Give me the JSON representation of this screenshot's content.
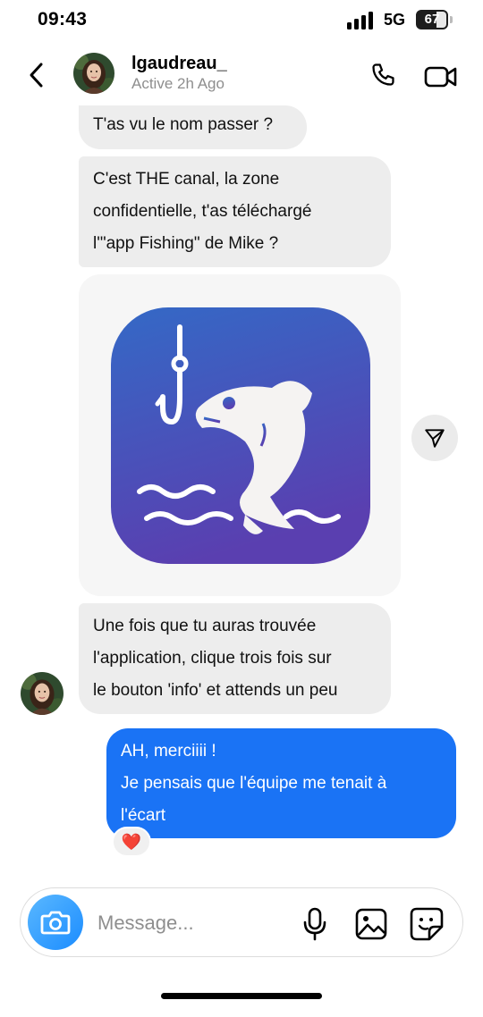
{
  "status_bar": {
    "time": "09:43",
    "network": "5G",
    "battery": "67",
    "battery_level": 0.67
  },
  "header": {
    "name": "lgaudreau_",
    "status": "Active 2h Ago"
  },
  "messages": {
    "m1": {
      "line1": "T'as vu le nom passer ?"
    },
    "m2": {
      "line1": "C'est THE canal, la zone",
      "line2": "confidentielle, t'as téléchargé",
      "line3": "l'\"app Fishing\" de Mike ?"
    },
    "m3": {
      "line1": "Une fois que tu auras trouvée",
      "line2": "l'application, clique trois fois sur",
      "line3": "le bouton 'info' et attends un peu"
    },
    "m4": {
      "line1": "AH, merciiii !",
      "line2": "Je pensais que l'équipe me tenait à",
      "line3": "l'écart"
    },
    "m4_reaction": "❤️"
  },
  "icons": {
    "back": "chevron-left-icon",
    "call": "phone-icon",
    "video": "video-camera-icon",
    "share": "send-icon",
    "camera": "camera-icon",
    "mic": "microphone-icon",
    "gallery": "image-icon",
    "sticker": "sticker-icon"
  },
  "composer": {
    "placeholder": "Message..."
  },
  "colors": {
    "outgoing_bubble": "#1a73f5",
    "incoming_bubble": "#ededed",
    "camera_button": "#1b8cff",
    "app_icon_top": "#3469c6",
    "app_icon_bottom": "#5a3fb0"
  }
}
